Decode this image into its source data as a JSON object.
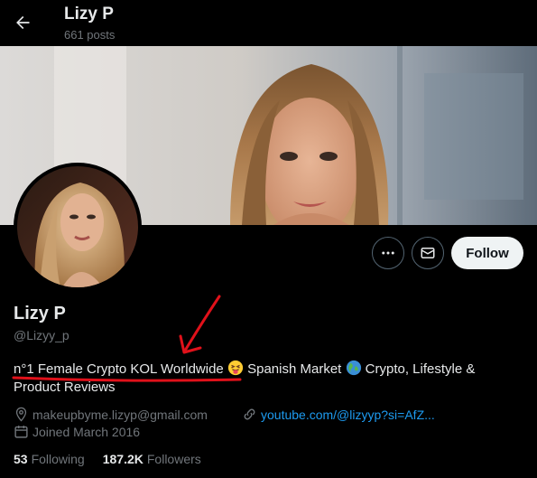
{
  "header": {
    "title": "Lizy P",
    "posts_count": "661 posts"
  },
  "profile": {
    "display_name": "Lizy P",
    "handle": "@Lizyy_p",
    "bio_highlight": "n°1 Female Crypto KOL Worldwide",
    "bio_part2": "Spanish Market",
    "bio_part3": "Crypto, Lifestyle &",
    "bio_part4": "Product Reviews",
    "email": "makeupbyme.lizyp@gmail.com",
    "website": "youtube.com/@lizyyp?si=AfZ...",
    "joined": "Joined March 2016",
    "following_count": "53",
    "following_label": "Following",
    "followers_count": "187.2K",
    "followers_label": "Followers"
  },
  "actions": {
    "follow_label": "Follow"
  },
  "icons": {
    "back": "arrow-left-icon",
    "more": "more-dots-icon",
    "message": "envelope-icon",
    "emoji_tongue": "squinting-tongue-emoji",
    "emoji_globe": "globe-emoji",
    "location": "location-pin-icon",
    "link": "link-icon",
    "calendar": "calendar-icon"
  },
  "colors": {
    "accent": "#1d9bf0",
    "annotation": "#e0111a",
    "muted": "#71767b"
  }
}
